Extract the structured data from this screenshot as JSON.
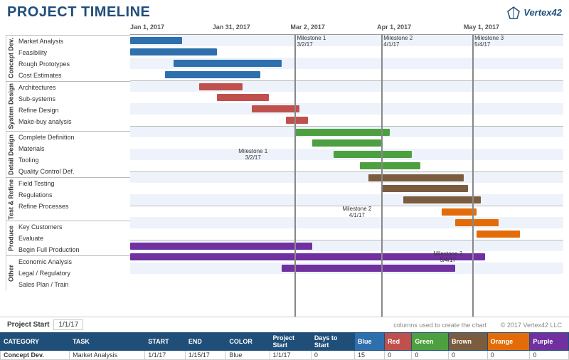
{
  "title": "PROJECT TIMELINE",
  "logo_text": "Vertex42",
  "date_labels": [
    "Jan 1, 2017",
    "Jan 31, 2017",
    "Mar 2, 2017",
    "Apr 1, 2017",
    "May 1, 2017"
  ],
  "milestones": [
    {
      "label": "Milestone 1\n3/2/17",
      "x_pct": 38
    },
    {
      "label": "Milestone 2\n4/1/17",
      "x_pct": 58
    },
    {
      "label": "Milestone 3\n5/4/17",
      "x_pct": 79
    }
  ],
  "groups": [
    {
      "category": "Concept Dev.",
      "tasks": [
        {
          "name": "Market Analysis",
          "color": "#2e6fad",
          "start_pct": 0,
          "width_pct": 12
        },
        {
          "name": "Feasibility",
          "color": "#2e6fad",
          "start_pct": 0,
          "width_pct": 20
        },
        {
          "name": "Rough Prototypes",
          "color": "#2e6fad",
          "start_pct": 10,
          "width_pct": 25
        },
        {
          "name": "Cost Estimates",
          "color": "#2e6fad",
          "start_pct": 8,
          "width_pct": 22
        }
      ]
    },
    {
      "category": "System Design",
      "tasks": [
        {
          "name": "Architectures",
          "color": "#c0504d",
          "start_pct": 16,
          "width_pct": 10
        },
        {
          "name": "Sub-systems",
          "color": "#c0504d",
          "start_pct": 20,
          "width_pct": 12
        },
        {
          "name": "Refine Design",
          "color": "#c0504d",
          "start_pct": 28,
          "width_pct": 11
        },
        {
          "name": "Make-buy analysis",
          "color": "#c0504d",
          "start_pct": 38,
          "width_pct": 5
        }
      ]
    },
    {
      "category": "Detail Design",
      "tasks": [
        {
          "name": "Complete Definition",
          "color": "#4da040",
          "start_pct": 38,
          "width_pct": 22
        },
        {
          "name": "Materials",
          "color": "#4da040",
          "start_pct": 42,
          "width_pct": 16
        },
        {
          "name": "Tooling",
          "color": "#4da040",
          "start_pct": 47,
          "width_pct": 18
        },
        {
          "name": "Quality Control Def.",
          "color": "#4da040",
          "start_pct": 53,
          "width_pct": 14
        }
      ]
    },
    {
      "category": "Test & Refine",
      "tasks": [
        {
          "name": "Field Testing",
          "color": "#7b5c3e",
          "start_pct": 55,
          "width_pct": 22
        },
        {
          "name": "Regulations",
          "color": "#7b5c3e",
          "start_pct": 58,
          "width_pct": 20
        },
        {
          "name": "Refine Processes",
          "color": "#7b5c3e",
          "start_pct": 63,
          "width_pct": 18
        }
      ]
    },
    {
      "category": "Produce",
      "tasks": [
        {
          "name": "Key Customers",
          "color": "#e36c09",
          "start_pct": 72,
          "width_pct": 10
        },
        {
          "name": "Evaluate",
          "color": "#e36c09",
          "start_pct": 75,
          "width_pct": 12
        },
        {
          "name": "Begin Full Production",
          "color": "#e36c09",
          "start_pct": 80,
          "width_pct": 10
        }
      ]
    },
    {
      "category": "Other",
      "tasks": [
        {
          "name": "Economic Analysis",
          "color": "#7030a0",
          "start_pct": 0,
          "width_pct": 42
        },
        {
          "name": "Legal / Regulatory",
          "color": "#7030a0",
          "start_pct": 0,
          "width_pct": 82
        },
        {
          "name": "Sales Plan / Train",
          "color": "#7030a0",
          "start_pct": 35,
          "width_pct": 40
        }
      ]
    }
  ],
  "project_start_label": "Project Start",
  "project_start_value": "1/1/17",
  "columns_note": "columns used to create the chart",
  "copyright": "© 2017 Vertex42 LLC",
  "table": {
    "headers": [
      "CATEGORY",
      "TASK",
      "START",
      "END",
      "COLOR",
      "Project Start",
      "Days to Start",
      "Blue",
      "Red",
      "Green",
      "Brown",
      "Orange",
      "Purple"
    ],
    "rows": [
      [
        "Concept Dev.",
        "Market Analysis",
        "1/1/17",
        "1/15/17",
        "Blue",
        "1/1/17",
        "0",
        "15",
        "0",
        "0",
        "0",
        "0",
        "0"
      ]
    ]
  }
}
